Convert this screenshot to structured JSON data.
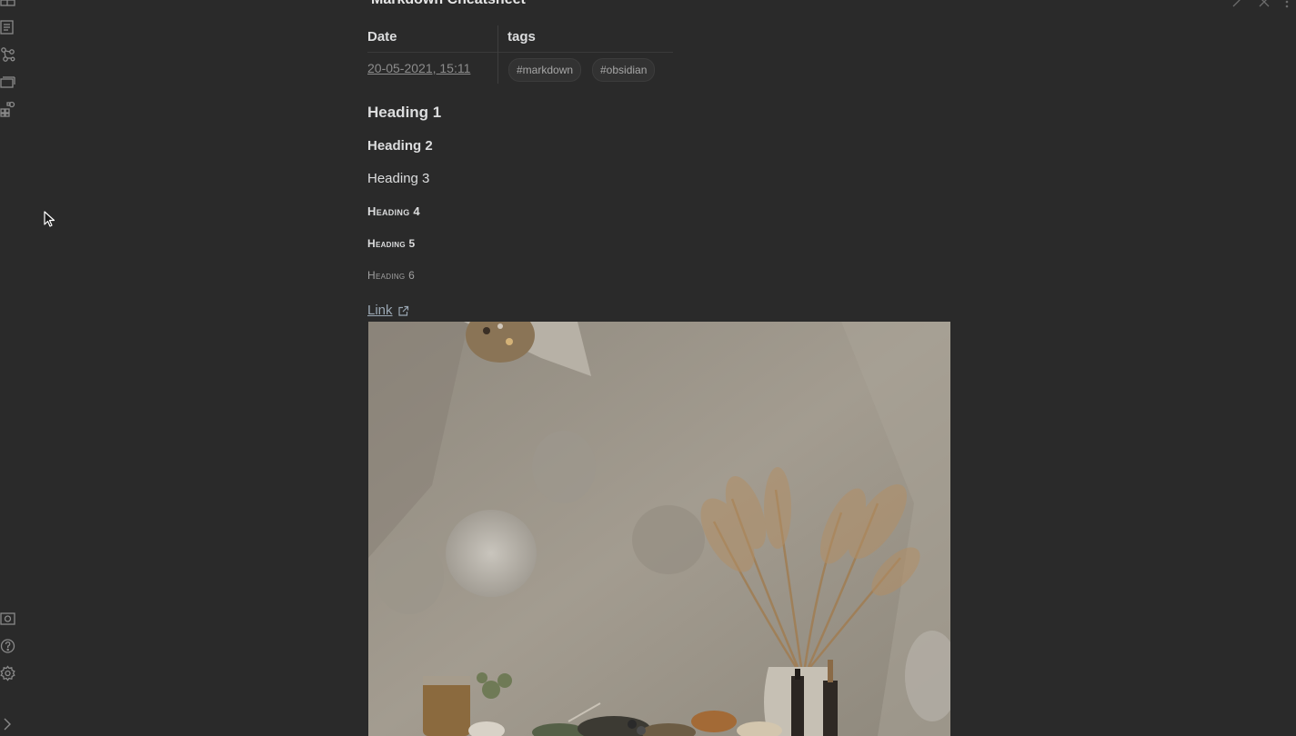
{
  "note": {
    "title": "Markdown Cheatsheet",
    "frontmatter": {
      "date_header": "Date",
      "tags_header": "tags",
      "date_value": "20-05-2021, 15:11",
      "tags": [
        "#markdown",
        "#obsidian"
      ]
    },
    "headings": {
      "h1": "Heading 1",
      "h2": "Heading 2",
      "h3": "Heading 3",
      "h4": "Heading 4",
      "h5": "Heading 5",
      "h6": "Heading 6"
    },
    "link_text": "Link"
  },
  "ribbon": {
    "top_icons": [
      "table-icon",
      "document-icon",
      "graph-icon",
      "stack-icon",
      "grid-icon"
    ],
    "bottom_icons": [
      "vault-icon",
      "help-icon",
      "settings-icon",
      "expand-icon"
    ]
  },
  "header_controls": [
    "edit-icon",
    "close-icon",
    "more-icon"
  ],
  "colors": {
    "background": "#2a2a2a",
    "text": "#dcddde",
    "muted": "#8c8c8c",
    "link": "#9aa7b3"
  }
}
